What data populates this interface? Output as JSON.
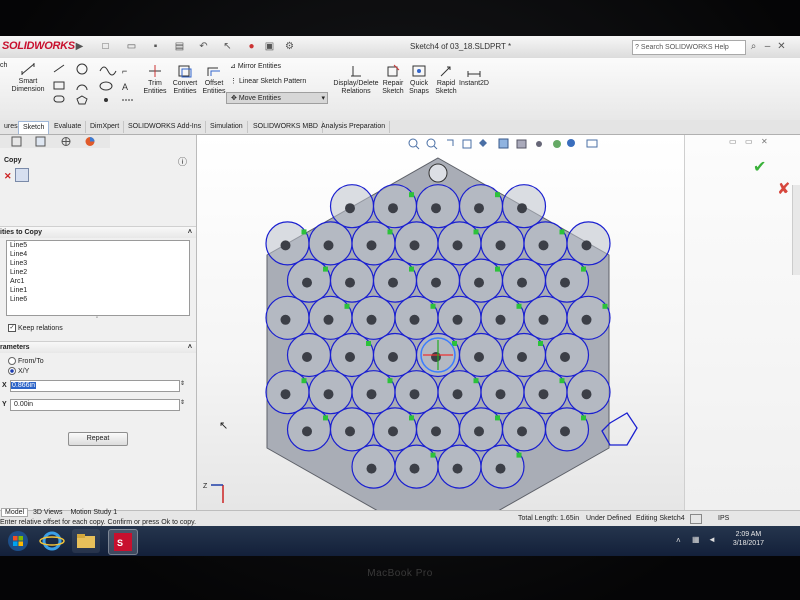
{
  "app": {
    "brand": "SOLIDWORKS",
    "document_title": "Sketch4 of 03_18.SLDPRT *",
    "search_placeholder": "Search SOLIDWORKS Help"
  },
  "ribbon": {
    "smart_dimension": "Smart Dimension",
    "trim_entities": "Trim Entities",
    "convert_entities": "Convert Entities",
    "offset_entities": "Offset Entities",
    "mirror_entities": "Mirror Entities",
    "linear_sketch_pattern": "Linear Sketch Pattern",
    "move_entities": "Move Entities",
    "display_delete_relations": "Display/Delete Relations",
    "repair_sketch": "Repair Sketch",
    "quick_snaps": "Quick Snaps",
    "rapid_sketch": "Rapid Sketch",
    "instant2d": "Instant2D"
  },
  "tabs": [
    "ures",
    "Sketch",
    "Evaluate",
    "DimXpert",
    "SOLIDWORKS Add-Ins",
    "Simulation",
    "SOLIDWORKS MBD",
    "Analysis Preparation"
  ],
  "active_tab": "Sketch",
  "property_manager": {
    "title": "Copy",
    "entities_section": "ities to Copy",
    "entities": [
      "Line5",
      "Line4",
      "Line3",
      "Line2",
      "Arc1",
      "Line1",
      "Line6"
    ],
    "keep_relations_label": "Keep relations",
    "keep_relations_checked": true,
    "parameters_section": "rameters",
    "option_from_to": "From/To",
    "option_xy": "X/Y",
    "selected_option": "X/Y",
    "dx_label": "X",
    "dx_value": "0.866in",
    "dy_label": "Y",
    "dy_value": "0.00in",
    "repeat_button": "Repeat"
  },
  "status": {
    "total_length": "Total Length: 1.65in",
    "definition": "Under Defined",
    "editing": "Editing Sketch4",
    "units": "IPS",
    "prompt": "Enter relative offset for each copy. Confirm or press Ok to copy."
  },
  "bottom_tabs": [
    "Model",
    "3D Views",
    "Motion Study 1"
  ],
  "taskbar": {
    "time": "2:09 AM",
    "date": "3/18/2017"
  },
  "laptop_label": "MacBook Pro",
  "colors": {
    "sketch_blue": "#1a1fd0",
    "relation_green": "#2cc23a",
    "hexagon_fill": "#a9adb6",
    "taskbar": "#1b2a45"
  }
}
